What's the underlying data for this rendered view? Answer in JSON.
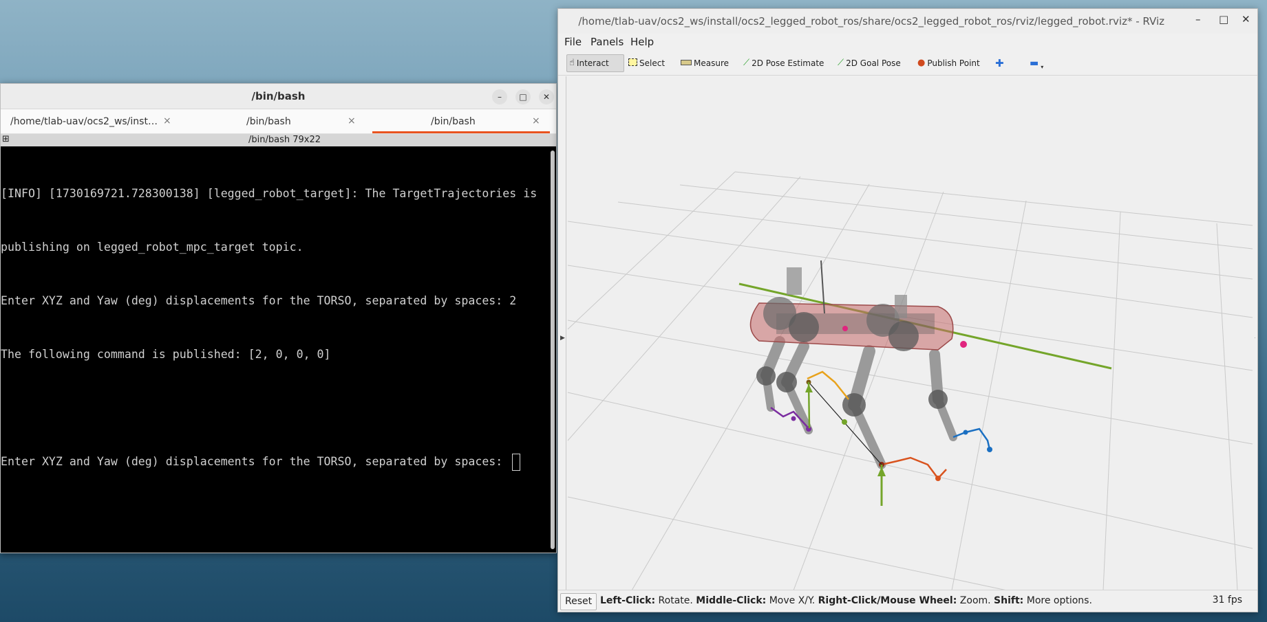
{
  "terminal": {
    "title": "/bin/bash",
    "buttons": {
      "minimize": "–",
      "maximize": "□",
      "close": "✕"
    },
    "tabs": [
      {
        "label": "/home/tlab-uav/ocs2_ws/inst…",
        "close": "×",
        "active": false
      },
      {
        "label": "/bin/bash",
        "close": "×",
        "active": false
      },
      {
        "label": "/bin/bash",
        "close": "×",
        "active": true
      }
    ],
    "status": "/bin/bash 79x22",
    "status_icon": "⊞",
    "lines": [
      "[INFO] [1730169721.728300138] [legged_robot_target]: The TargetTrajectories is",
      "publishing on legged_robot_mpc_target topic.",
      "Enter XYZ and Yaw (deg) displacements for the TORSO, separated by spaces: 2",
      "The following command is published: [2, 0, 0, 0]",
      "",
      "Enter XYZ and Yaw (deg) displacements for the TORSO, separated by spaces: "
    ]
  },
  "rviz": {
    "title": "/home/tlab-uav/ocs2_ws/install/ocs2_legged_robot_ros/share/ocs2_legged_robot_ros/rviz/legged_robot.rviz* - RViz",
    "buttons": {
      "minimize": "–",
      "maximize": "□",
      "close": "✕"
    },
    "menu": [
      "File",
      "Panels",
      "Help"
    ],
    "tools": [
      {
        "label": "Interact",
        "icon": "hand-icon"
      },
      {
        "label": "Select",
        "icon": "select-box-icon"
      },
      {
        "label": "Measure",
        "icon": "ruler-icon"
      },
      {
        "label": "2D Pose Estimate",
        "icon": "green-arrow-icon"
      },
      {
        "label": "2D Goal Pose",
        "icon": "green-arrow-icon"
      },
      {
        "label": "Publish Point",
        "icon": "map-pin-icon"
      }
    ],
    "bottom": {
      "reset": "Reset",
      "help": [
        {
          "key": "Left-Click:",
          "desc": "Rotate."
        },
        {
          "key": "Middle-Click:",
          "desc": "Move X/Y."
        },
        {
          "key": "Right-Click/Mouse Wheel:",
          "desc": "Zoom."
        },
        {
          "key": "Shift:",
          "desc": "More options."
        }
      ],
      "fps": "31 fps"
    },
    "colors": {
      "grid": "#c9c9c9",
      "axis_x": "#74a52a",
      "traj_front_left": "#7b2da0",
      "traj_rear_left": "#e8a21c",
      "traj_front_right": "#1a6fc2",
      "traj_rear_right": "#d9531e",
      "body": "#c46a6a"
    }
  }
}
